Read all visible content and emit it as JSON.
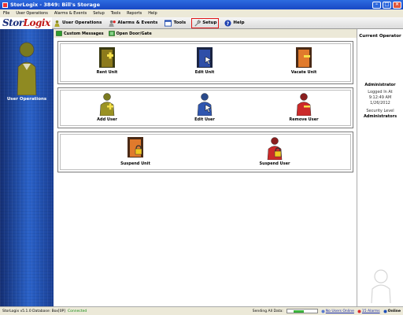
{
  "window": {
    "title": "StorLogix - 3849: Bill's Storage"
  },
  "menu": [
    "File",
    "User Operations",
    "Alarms & Events",
    "Setup",
    "Tools",
    "Reports",
    "Help"
  ],
  "logo": {
    "part1": "Stor",
    "part2": "Logix"
  },
  "toolbar": {
    "user_ops": "User Operations",
    "alarms": "Alarms & Events",
    "tools": "Tools",
    "setup": "Setup",
    "help": "Help"
  },
  "subtoolbar": {
    "custom_messages": "Custom Messages",
    "open_door": "Open Door/Gate"
  },
  "sidebar": {
    "label": "User Operations"
  },
  "tiles": {
    "rent_unit": "Rent Unit",
    "edit_unit": "Edit Unit",
    "vacate_unit": "Vacate Unit",
    "add_user": "Add User",
    "edit_user": "Edit User",
    "remove_user": "Remove User",
    "suspend_unit": "Suspend Unit",
    "suspend_user": "Suspend User"
  },
  "operator": {
    "header": "Current Operator",
    "name": "Administrator",
    "logged_in_label": "Logged In At",
    "time": "9:12:49 AM",
    "date": "1/26/2012",
    "security_label": "Security Level",
    "security_value": "Administrators"
  },
  "status": {
    "version": "StorLogix v5.1.0 Database: Box[0P]",
    "connected": "Connected",
    "sending": "Sending All Data:",
    "progress_fraction": 0.45,
    "users_online": "No Users Online",
    "alarms": "15 Alarms",
    "online": "Online"
  },
  "colors": {
    "accent": "#2a62c9",
    "active_outline": "#e01616"
  }
}
